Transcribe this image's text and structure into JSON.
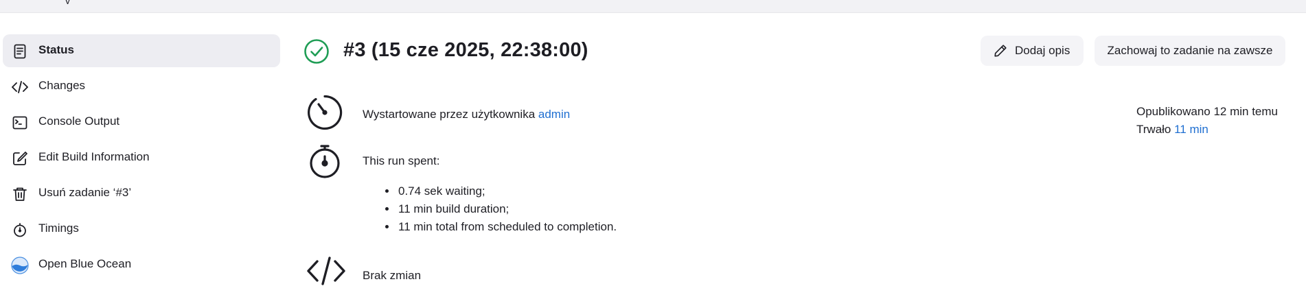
{
  "topbar": {
    "cropped_text": "y"
  },
  "sidebar": {
    "items": [
      {
        "label": "Status",
        "icon": "document-icon",
        "active": true
      },
      {
        "label": "Changes",
        "icon": "code-icon"
      },
      {
        "label": "Console Output",
        "icon": "terminal-icon"
      },
      {
        "label": "Edit Build Information",
        "icon": "edit-icon"
      },
      {
        "label": "Usuń zadanie ‘#3’",
        "icon": "trash-icon"
      },
      {
        "label": "Timings",
        "icon": "stopwatch-icon"
      },
      {
        "label": "Open Blue Ocean",
        "icon": "blue-ocean-icon"
      }
    ]
  },
  "build": {
    "title": "#3 (15 cze 2025, 22:38:00)",
    "status": "success",
    "add_description_label": "Dodaj opis",
    "keep_forever_label": "Zachowaj to zadanie na zawsze",
    "started_by_text": "Wystartowane przez użytkownika ",
    "started_by_user": "admin",
    "published": "Opublikowano 12 min temu",
    "duration_prefix": "Trwało ",
    "duration_value": "11 min",
    "run_spent_title": "This run spent:",
    "run_spent_items": [
      "0.74 sek waiting;",
      "11 min build duration;",
      "11 min total from scheduled to completion."
    ],
    "changes_text": "Brak zmian"
  },
  "colors": {
    "accent_link": "#1f6fd1",
    "success_green": "#1f9d55",
    "sidebar_active_bg": "#ededf2",
    "button_bg": "#f4f4f7"
  }
}
